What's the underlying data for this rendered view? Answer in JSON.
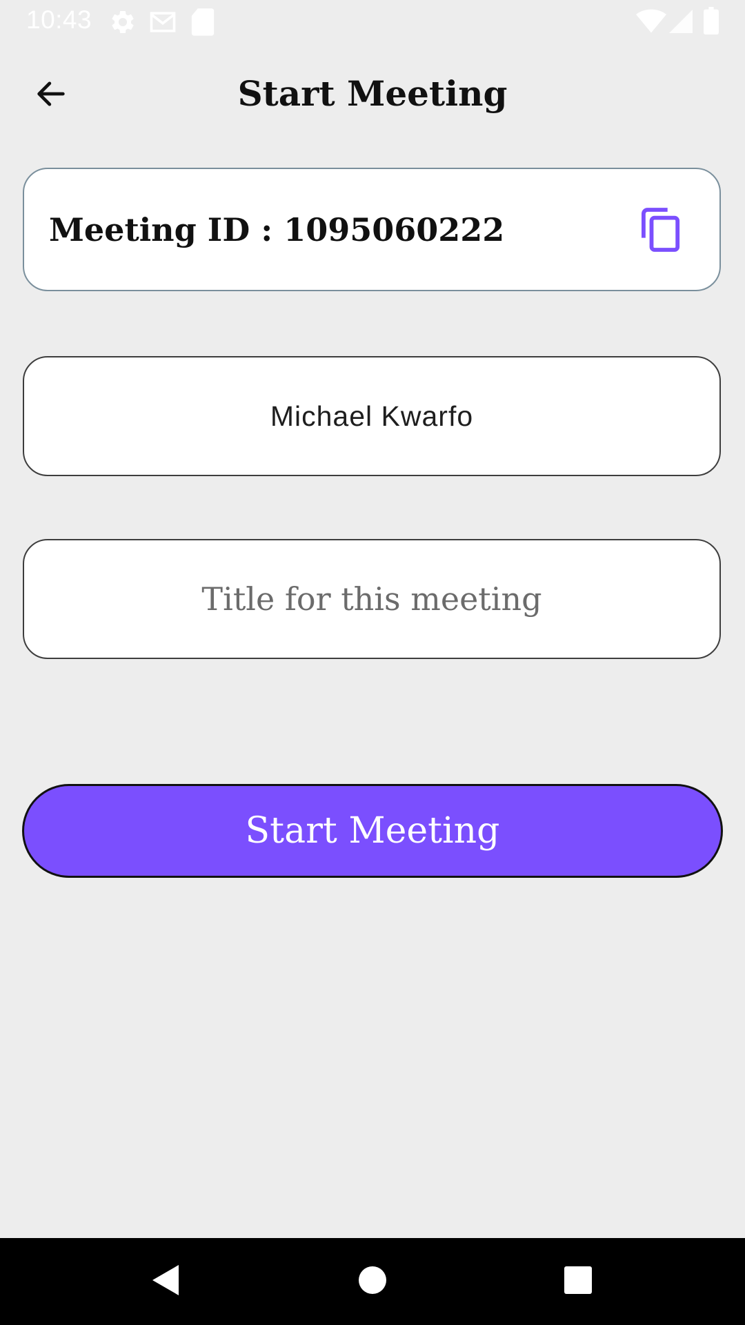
{
  "status_bar": {
    "time": "10:43",
    "left_icons": [
      "gear-icon",
      "gmail-icon",
      "sd-card-icon"
    ],
    "right_icons": [
      "wifi-icon",
      "cell-signal-icon",
      "battery-icon"
    ]
  },
  "app_bar": {
    "back_icon": "arrow-back-icon",
    "title": "Start Meeting"
  },
  "meeting_id": {
    "text": "Meeting ID : 1095060222",
    "copy_icon": "copy-icon"
  },
  "name_field": {
    "value": "Michael Kwarfo"
  },
  "title_field": {
    "value": "",
    "placeholder": "Title for this meeting"
  },
  "start_button": {
    "label": "Start Meeting"
  },
  "nav_bar": {
    "icons": [
      "back-triangle-icon",
      "home-circle-icon",
      "recents-square-icon"
    ]
  },
  "colors": {
    "accent": "#7b4ffe",
    "background": "#ededed",
    "copy_icon": "#7b4ffe"
  }
}
